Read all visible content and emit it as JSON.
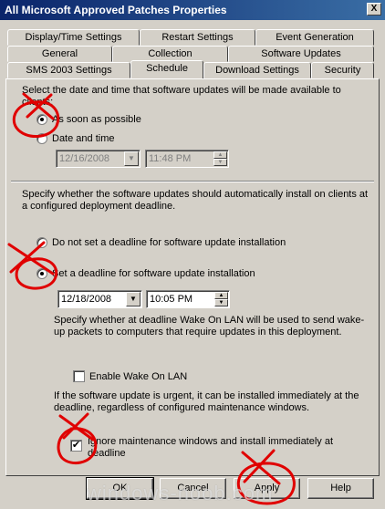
{
  "window": {
    "title": "All Microsoft Approved Patches Properties",
    "close_label": "X"
  },
  "tabs": {
    "row1": [
      "Display/Time Settings",
      "Restart Settings",
      "Event Generation"
    ],
    "row2": [
      "General",
      "Collection",
      "Software Updates"
    ],
    "row3": [
      "SMS 2003 Settings",
      "Schedule",
      "Download Settings",
      "Security"
    ],
    "active": "Schedule"
  },
  "availability": {
    "prompt": "Select the date and time that software updates will be made available to clients:",
    "option_asap": "As soon as possible",
    "option_datetime": "Date and time",
    "date_value": "12/16/2008",
    "time_value": "11:48 PM"
  },
  "deadline": {
    "prompt": "Specify whether the software updates should automatically install on clients at a configured deployment deadline.",
    "option_no_deadline": "Do not set a deadline for software update installation",
    "option_set_deadline": "Set a deadline for software update installation",
    "date_value": "12/18/2008",
    "time_value": "10:05 PM",
    "wol_prompt": "Specify whether at deadline Wake On LAN will be used to send wake-up packets to computers that require updates in this deployment.",
    "wol_label": "Enable Wake On LAN",
    "urgent_prompt": "If the software update is urgent, it can be installed immediately at the deadline, regardless of configured maintenance windows.",
    "ignore_mw_label": "Ignore maintenance windows and install immediately at deadline",
    "check_mark": "✔"
  },
  "buttons": {
    "ok": "OK",
    "cancel": "Cancel",
    "apply": "Apply",
    "help": "Help"
  },
  "glyphs": {
    "dropdown": "▼",
    "spin_up": "▲",
    "spin_down": "▼"
  },
  "watermark": "windows-noob.com",
  "colors": {
    "titlebar_start": "#0a246a",
    "titlebar_end": "#3a6ea5",
    "face": "#d4d0c8",
    "annotation_red": "#e00000"
  }
}
